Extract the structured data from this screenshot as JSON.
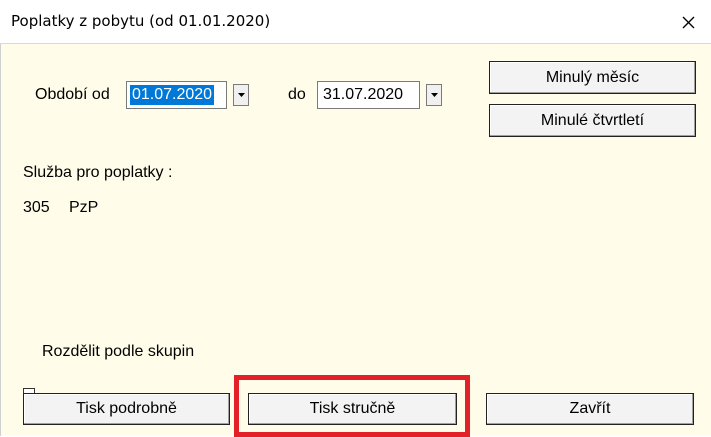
{
  "window": {
    "title": "Poplatky z pobytu (od 01.01.2020)"
  },
  "period": {
    "from_label": "Období od",
    "from_value": "01.07.2020",
    "to_label": "do",
    "to_value": "31.07.2020"
  },
  "quick_buttons": {
    "last_month": "Minulý měsíc",
    "last_quarter": "Minulé čtvrtletí"
  },
  "service": {
    "label": "Služba pro poplatky :",
    "code": "305",
    "name": "PzP"
  },
  "split_by_groups": {
    "label": "Rozdělit podle skupin",
    "checked": false
  },
  "footer": {
    "print_detailed": "Tisk podrobně",
    "print_brief": "Tisk stručně",
    "close": "Zavřít"
  },
  "colors": {
    "dialog_background": "#fffdea",
    "selection": "#0078d7",
    "highlight_box": "#e32027"
  },
  "icons": [
    "close-icon",
    "dropdown-arrow-icon"
  ]
}
